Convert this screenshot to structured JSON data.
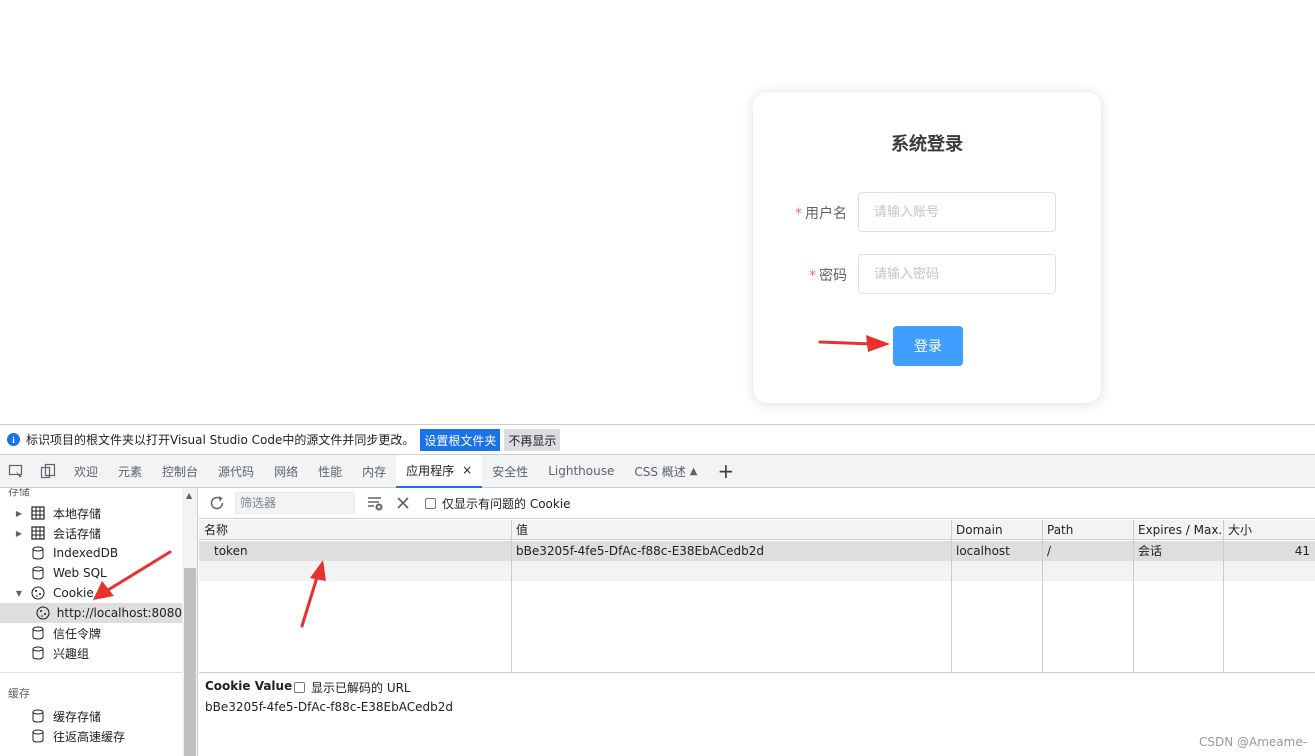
{
  "login": {
    "title": "系统登录",
    "username_label": "用户名",
    "username_placeholder": "请输入账号",
    "password_label": "密码",
    "password_placeholder": "请输入密码",
    "submit_label": "登录",
    "required_mark": "*"
  },
  "infobar": {
    "icon": "info-icon",
    "message": "标识项目的根文件夹以打开Visual Studio Code中的源文件并同步更改。",
    "primary_button": "设置根文件夹",
    "secondary_button": "不再显示"
  },
  "devtools": {
    "tabs": [
      {
        "label": "欢迎"
      },
      {
        "label": "元素"
      },
      {
        "label": "控制台"
      },
      {
        "label": "源代码"
      },
      {
        "label": "网络"
      },
      {
        "label": "性能"
      },
      {
        "label": "内存"
      },
      {
        "label": "应用程序",
        "active": true,
        "close": "×"
      },
      {
        "label": "安全性"
      },
      {
        "label": "Lighthouse"
      },
      {
        "label": "CSS 概述"
      }
    ],
    "plus_label": "+"
  },
  "sidebar": {
    "storage_header": "存储",
    "items": [
      {
        "label": "本地存储",
        "icon": "grid-icon",
        "expandable": true
      },
      {
        "label": "会话存储",
        "icon": "grid-icon",
        "expandable": true
      },
      {
        "label": "IndexedDB",
        "icon": "database-icon"
      },
      {
        "label": "Web SQL",
        "icon": "database-icon"
      },
      {
        "label": "Cookie",
        "icon": "cookie-icon",
        "expanded": true
      },
      {
        "label": "http://localhost:8080",
        "icon": "cookie-icon",
        "selected": true
      },
      {
        "label": "信任令牌",
        "icon": "database-icon"
      },
      {
        "label": "兴趣组",
        "icon": "database-icon"
      }
    ],
    "cache_header": "缓存",
    "cache_items": [
      {
        "label": "缓存存储",
        "icon": "database-icon"
      },
      {
        "label": "往返高速缓存",
        "icon": "database-icon"
      }
    ]
  },
  "cookies": {
    "filter_placeholder": "筛选器",
    "only_issues_label": "仅显示有问题的 Cookie",
    "columns": [
      "名称",
      "值",
      "Domain",
      "Path",
      "Expires / Max...",
      "大小"
    ],
    "rows": [
      {
        "name": "token",
        "value": "bBe3205f-4fe5-DfAc-f88c-E38EbACedb2d",
        "domain": "localhost",
        "path": "/",
        "expires": "会话",
        "size": "41"
      }
    ],
    "value_pane": {
      "title": "Cookie Value",
      "decode_label": "显示已解码的 URL",
      "value": "bBe3205f-4fe5-DfAc-f88c-E38EbACedb2d"
    }
  },
  "watermark": "CSDN @Ameame-",
  "colors": {
    "primary_button": "#409eff",
    "required": "#f56c6c",
    "devtools_accent": "#1a73e8",
    "annotation_arrow": "#e8312f"
  }
}
